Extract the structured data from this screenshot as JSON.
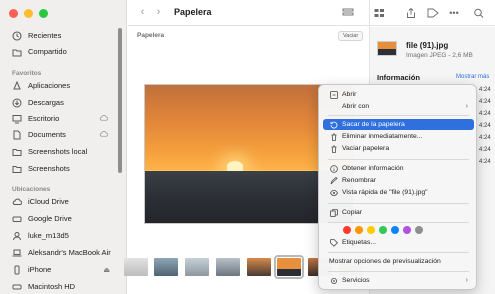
{
  "window": {
    "title": "Papelera"
  },
  "sidebar": {
    "top_items": [
      {
        "label": "Recientes",
        "icon": "clock-icon"
      },
      {
        "label": "Compartido",
        "icon": "shared-folder-icon"
      }
    ],
    "favorites_header": "Favoritos",
    "favorites": [
      {
        "label": "Aplicaciones",
        "icon": "applications-icon"
      },
      {
        "label": "Descargas",
        "icon": "downloads-icon"
      },
      {
        "label": "Escritorio",
        "icon": "desktop-icon"
      },
      {
        "label": "Documents",
        "icon": "document-icon"
      },
      {
        "label": "Screenshots local",
        "icon": "folder-icon"
      },
      {
        "label": "Screenshots",
        "icon": "folder-icon"
      }
    ],
    "locations_header": "Ubicaciones",
    "locations": [
      {
        "label": "iCloud Drive",
        "icon": "cloud-icon"
      },
      {
        "label": "Google Drive",
        "icon": "drive-icon"
      },
      {
        "label": "luke_m13d5",
        "icon": "user-icon"
      },
      {
        "label": "Aleksandr's MacBook Air",
        "icon": "laptop-icon"
      },
      {
        "label": "iPhone",
        "icon": "phone-icon"
      },
      {
        "label": "Macintosh HD",
        "icon": "disk-icon"
      }
    ]
  },
  "content": {
    "path_label": "Papelera",
    "empty_button": "Vaciar"
  },
  "info_panel": {
    "file_name": "file (91).jpg",
    "file_kind": "Imagen JPEG - 2,6 MB",
    "section": "Información",
    "more": "Mostrar más",
    "times": [
      "4:24",
      "4:24",
      "4:24",
      "4:24",
      "4:24",
      "4:24",
      "4:24"
    ]
  },
  "context_menu": {
    "items": [
      {
        "label": "Abrir",
        "icon": "open-icon"
      },
      {
        "label": "Abrir con",
        "submenu": true
      },
      {
        "label": "Sacar de la papelera",
        "icon": "restore-icon",
        "selected": true
      },
      {
        "label": "Eliminar inmediatamente...",
        "icon": "delete-icon"
      },
      {
        "label": "Vaciar papelera",
        "icon": "trash-icon"
      },
      {
        "label": "Obtener información",
        "icon": "info-icon"
      },
      {
        "label": "Renombrar",
        "icon": "rename-icon"
      },
      {
        "label": "Vista rápida de \"file (91).jpg\"",
        "icon": "eye-icon"
      },
      {
        "label": "Copiar",
        "icon": "copy-icon"
      },
      {
        "label": "Etiquetas...",
        "icon": "tag-icon"
      },
      {
        "label": "Mostrar opciones de previsualización"
      },
      {
        "label": "Servicios",
        "icon": "gear-icon",
        "submenu": true
      }
    ],
    "tag_colors": [
      "#ff3b30",
      "#ff9500",
      "#ffcc00",
      "#34c759",
      "#0a84ff",
      "#af52de",
      "#8e8e93"
    ],
    "accent": "#2f6fde"
  }
}
